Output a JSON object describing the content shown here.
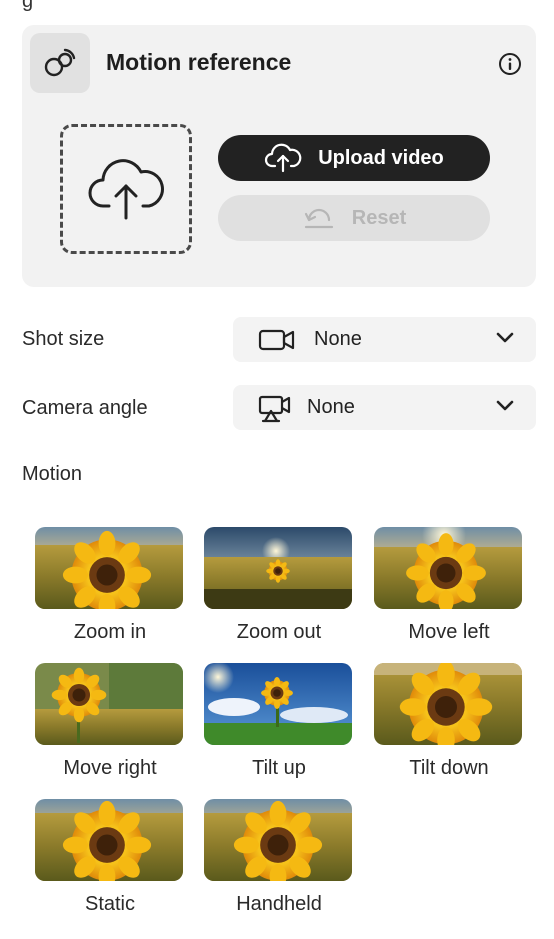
{
  "motion_reference": {
    "title": "Motion reference",
    "upload_label": "Upload video",
    "reset_label": "Reset"
  },
  "shot_size": {
    "label": "Shot size",
    "value": "None"
  },
  "camera_angle": {
    "label": "Camera angle",
    "value": "None"
  },
  "motion": {
    "label": "Motion",
    "options": [
      {
        "label": "Zoom in"
      },
      {
        "label": "Zoom out"
      },
      {
        "label": "Move left"
      },
      {
        "label": "Move right"
      },
      {
        "label": "Tilt up"
      },
      {
        "label": "Tilt down"
      },
      {
        "label": "Static"
      },
      {
        "label": "Handheld"
      }
    ]
  },
  "icons": {
    "motion_reference": "motion-reference-icon",
    "info": "info-icon",
    "upload": "cloud-upload-icon",
    "reset": "reset-icon",
    "shot_size": "video-camera-icon",
    "camera_angle": "camera-angle-icon",
    "dropdown": "chevron-down-icon"
  },
  "colors": {
    "card_bg": "#f2f2f2",
    "primary_button": "#222222",
    "disabled_button": "#e0e0e0",
    "picker_bg": "#f3f3f3"
  }
}
